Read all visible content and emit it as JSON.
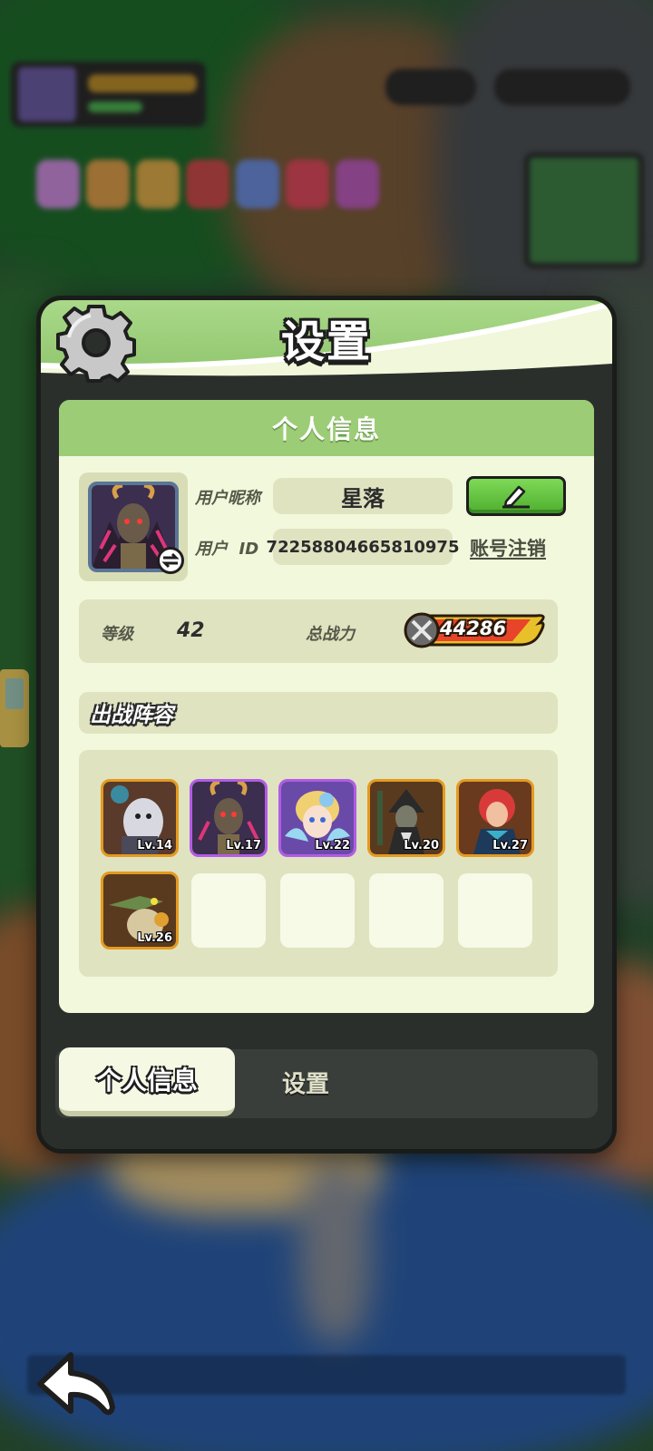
{
  "dialog": {
    "title": "设置",
    "icon": "gear-icon"
  },
  "profile": {
    "section_title": "个人信息",
    "nickname_label": "用户昵称",
    "nickname": "星落",
    "id_label": "用户  ID",
    "user_id": "72258804665810975",
    "cancel_account": "账号注销",
    "level_label": "等级",
    "level": "42",
    "power_label": "总战力",
    "power": "44286"
  },
  "lineup": {
    "title": "出战阵容",
    "heroes": [
      {
        "level": "Lv.14",
        "rarity_color": "#e59a1f"
      },
      {
        "level": "Lv.17",
        "rarity_color": "#b35be6"
      },
      {
        "level": "Lv.22",
        "rarity_color": "#b35be6"
      },
      {
        "level": "Lv.20",
        "rarity_color": "#e59a1f"
      },
      {
        "level": "Lv.27",
        "rarity_color": "#e59a1f"
      },
      {
        "level": "Lv.26",
        "rarity_color": "#e59a1f"
      }
    ],
    "empty_slots": 4
  },
  "tabs": [
    {
      "label": "个人信息",
      "active": true
    },
    {
      "label": "设置",
      "active": false
    }
  ],
  "colors": {
    "panel_green": "#9ccd76",
    "card_bg": "#f2f8dc",
    "edit_button": "#5cc13a",
    "legend_frame": "#e59a1f",
    "epic_frame": "#b35be6"
  }
}
